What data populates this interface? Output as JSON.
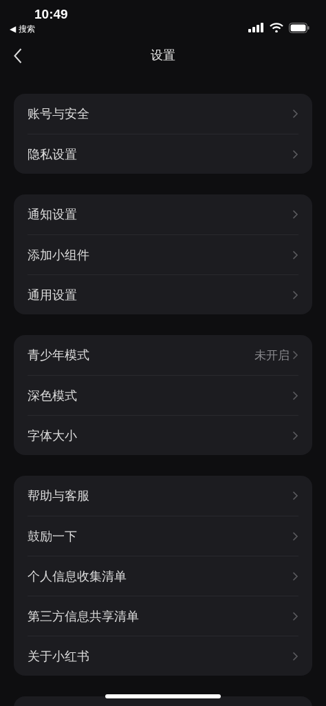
{
  "status_bar": {
    "time": "10:49",
    "back_app": "◀ 搜索"
  },
  "nav_bar": {
    "title": "设置"
  },
  "groups": [
    {
      "items": [
        {
          "label": "账号与安全"
        },
        {
          "label": "隐私设置"
        }
      ]
    },
    {
      "items": [
        {
          "label": "通知设置"
        },
        {
          "label": "添加小组件"
        },
        {
          "label": "通用设置"
        }
      ]
    },
    {
      "items": [
        {
          "label": "青少年模式",
          "value": "未开启"
        },
        {
          "label": "深色模式"
        },
        {
          "label": "字体大小"
        }
      ]
    },
    {
      "items": [
        {
          "label": "帮助与客服"
        },
        {
          "label": "鼓励一下"
        },
        {
          "label": "个人信息收集清单"
        },
        {
          "label": "第三方信息共享清单"
        },
        {
          "label": "关于小红书"
        }
      ]
    }
  ],
  "more_cards_below": true
}
